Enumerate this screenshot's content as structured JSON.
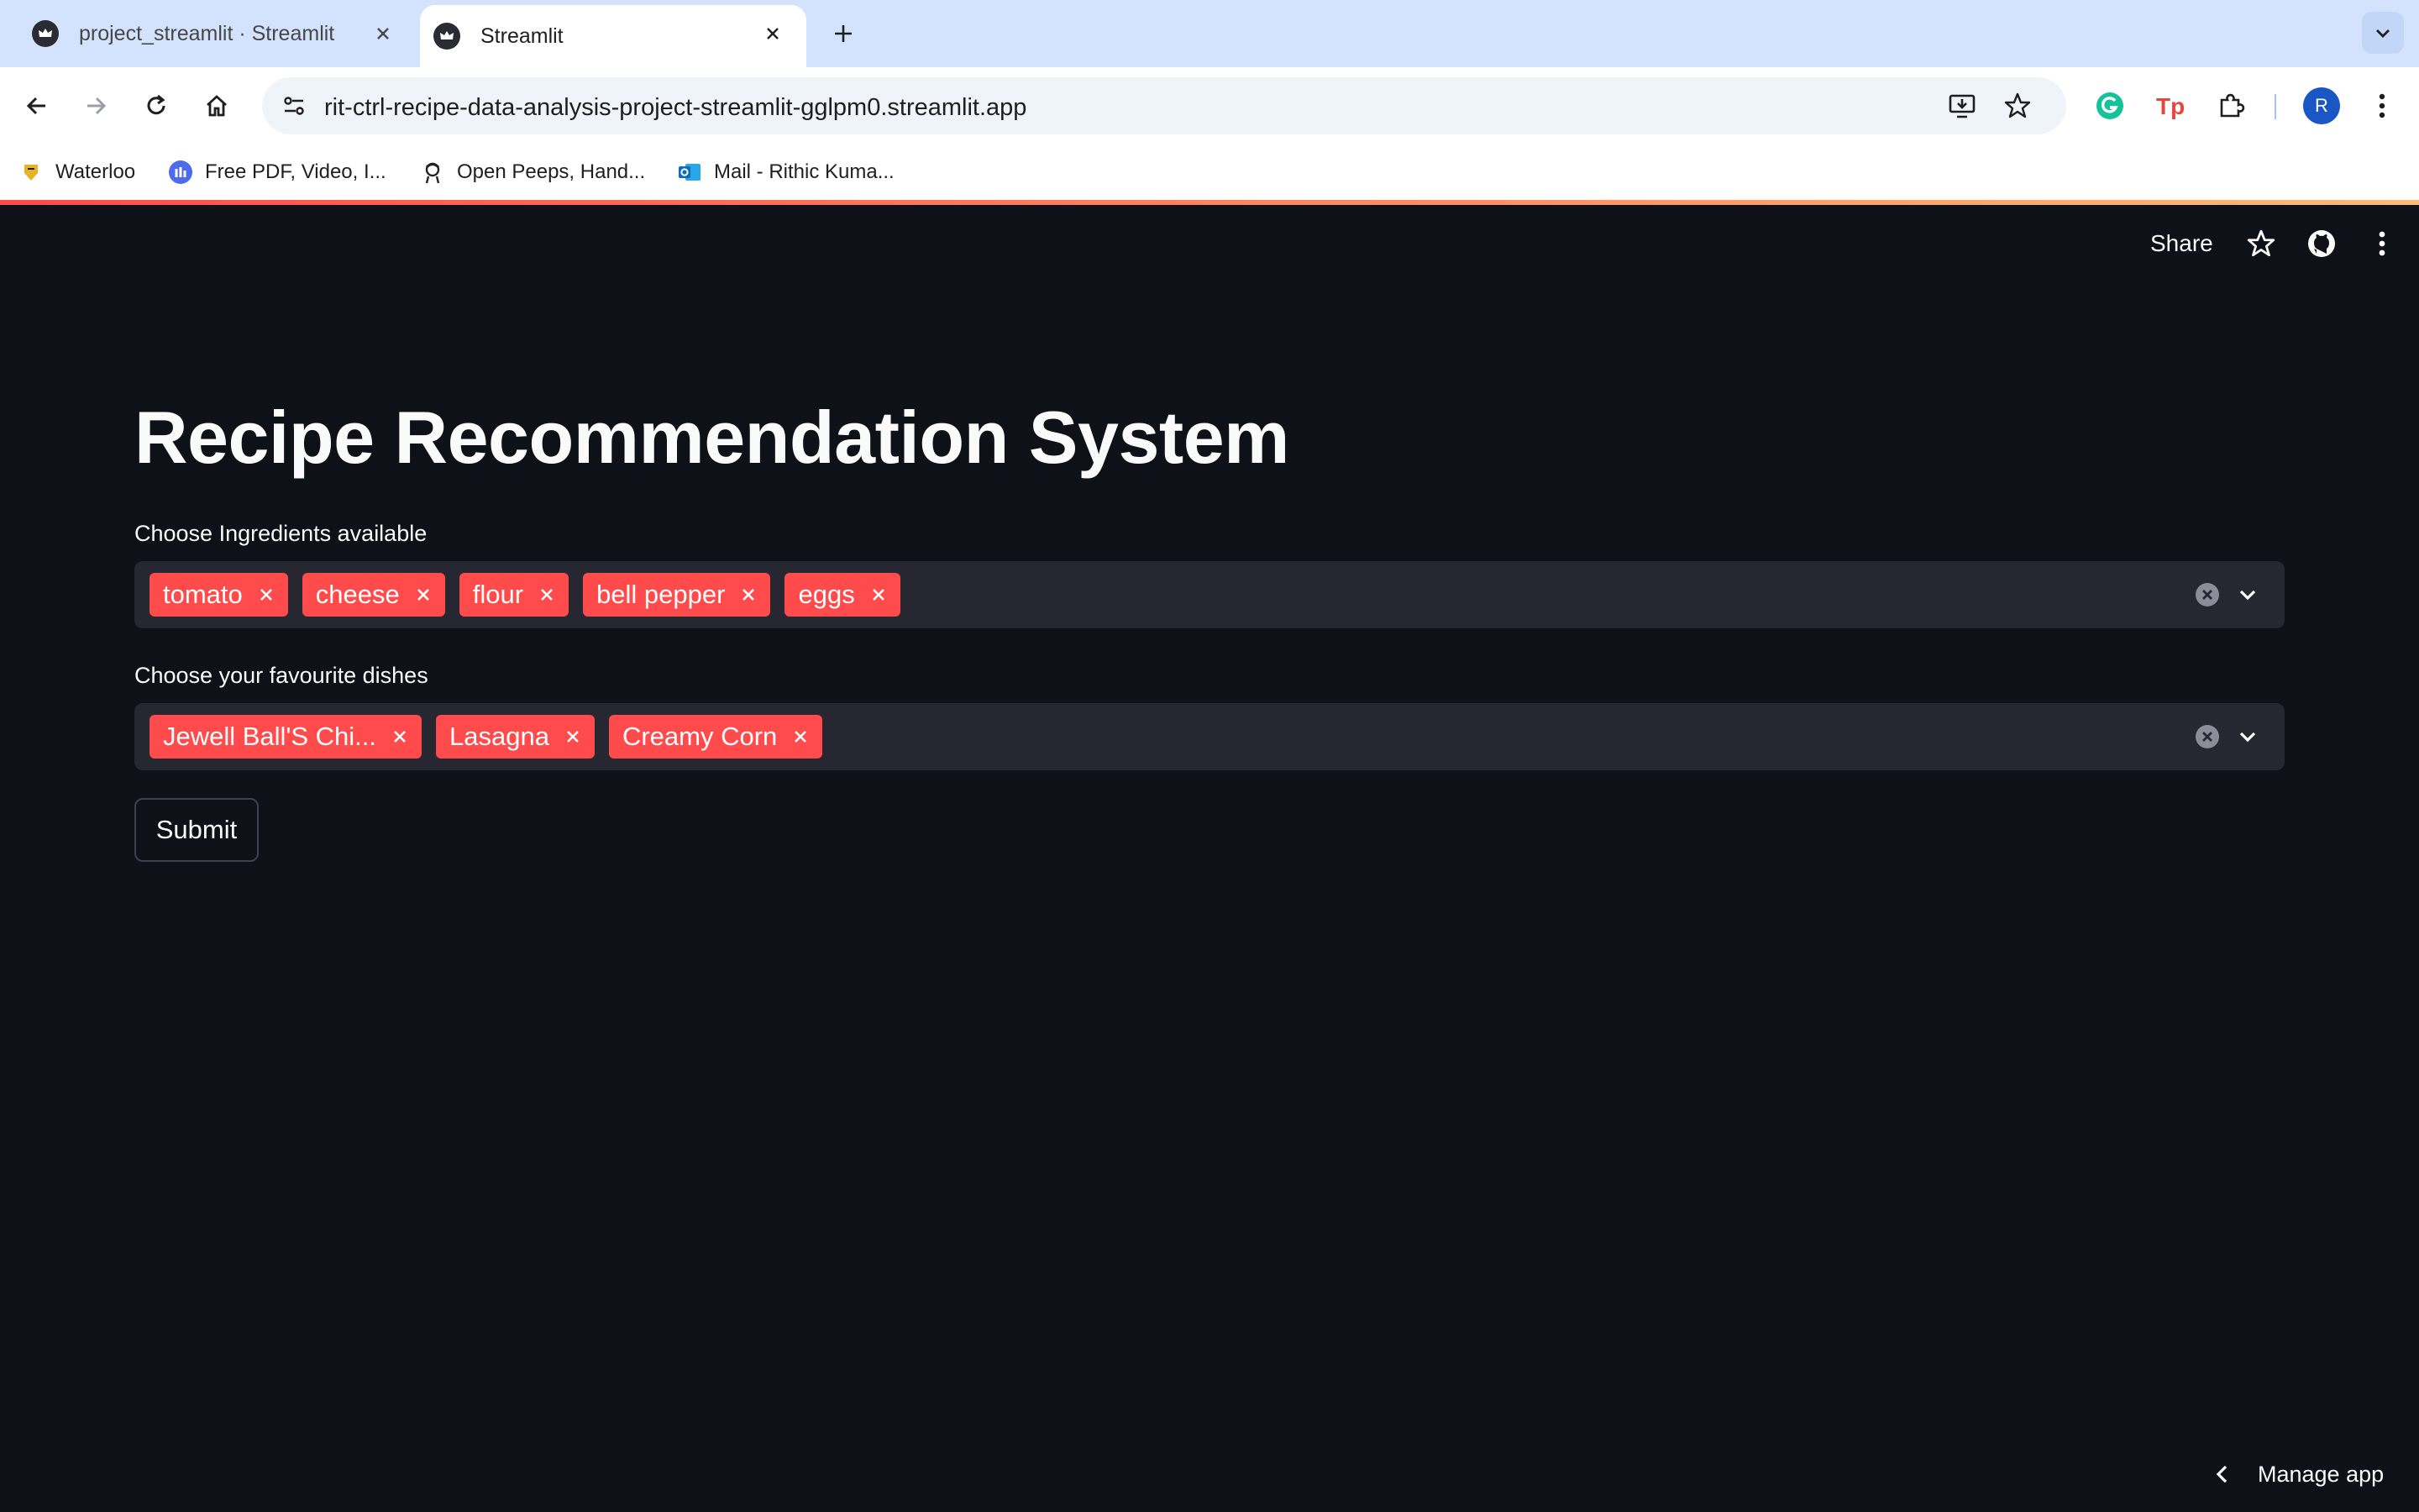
{
  "browser": {
    "tabs": [
      {
        "title": "project_streamlit · Streamlit",
        "active": false
      },
      {
        "title": "Streamlit",
        "active": true
      }
    ],
    "url": "rit-ctrl-recipe-data-analysis-project-streamlit-gglpm0.streamlit.app",
    "profile_initial": "R",
    "bookmarks": [
      {
        "label": "Waterloo",
        "icon": "waterloo-icon"
      },
      {
        "label": "Free PDF, Video, I...",
        "icon": "ilovepdf-icon"
      },
      {
        "label": "Open Peeps, Hand...",
        "icon": "open-peeps-icon"
      },
      {
        "label": "Mail - Rithic Kuma...",
        "icon": "outlook-icon"
      }
    ]
  },
  "app": {
    "header": {
      "share_label": "Share"
    },
    "title": "Recipe Recommendation System",
    "ingredients": {
      "label": "Choose Ingredients available",
      "selected": [
        "tomato",
        "cheese",
        "flour",
        "bell pepper",
        "eggs"
      ]
    },
    "dishes": {
      "label": "Choose your favourite dishes",
      "selected": [
        "Jewell Ball'S Chi...",
        "Lasagna",
        "Creamy Corn"
      ]
    },
    "submit_label": "Submit",
    "manage_app_label": "Manage app"
  },
  "colors": {
    "app_background": "#0e1117",
    "chip": "#ff4b4b",
    "input_background": "#262730",
    "tab_strip": "#d3e3fd"
  }
}
